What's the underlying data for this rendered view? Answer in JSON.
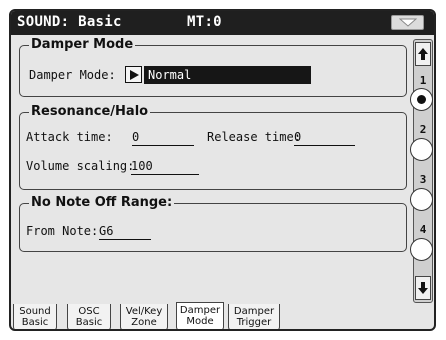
{
  "header": {
    "title": "SOUND: Basic",
    "mode": "MT:0"
  },
  "damper_mode": {
    "section_title": "Damper Mode",
    "label": "Damper Mode:",
    "value": "Normal"
  },
  "resonance": {
    "section_title": "Resonance/Halo",
    "attack_label": "Attack time:",
    "attack_value": "0",
    "release_label": "Release time:",
    "release_value": "0",
    "volume_label": "Volume scaling:",
    "volume_value": "100"
  },
  "note_off": {
    "section_title": "No Note Off Range:",
    "from_label": "From Note:",
    "from_value": "G6"
  },
  "pages": {
    "items": [
      "1",
      "2",
      "3",
      "4"
    ],
    "selected": "1"
  },
  "tabs": [
    {
      "line1": "Sound",
      "line2": "Basic"
    },
    {
      "line1": "OSC",
      "line2": "Basic"
    },
    {
      "line1": "Vel/Key",
      "line2": "Zone"
    },
    {
      "line1": "Damper",
      "line2": "Mode"
    },
    {
      "line1": "Damper",
      "line2": "Trigger"
    }
  ],
  "active_tab": "Damper Mode",
  "icons": {
    "menu": "menu-triangle-icon",
    "scroll_up": "arrow-up-icon",
    "scroll_down": "arrow-down-icon",
    "dropdown": "play-arrow-icon"
  }
}
